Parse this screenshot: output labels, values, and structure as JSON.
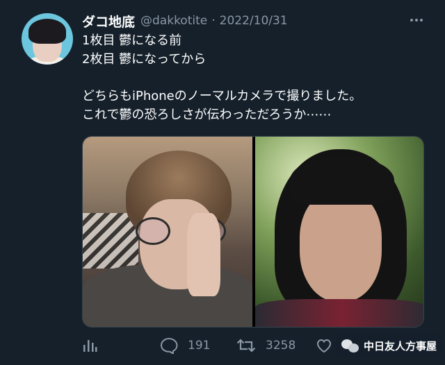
{
  "author": {
    "display_name": "ダコ地底",
    "handle": "@dakkotite",
    "separator": "·",
    "date": "2022/10/31"
  },
  "tweet": {
    "lines": [
      "1枚目  鬱になる前",
      "2枚目  鬱になってから",
      "",
      "どちらもiPhoneのノーマルカメラで撮りました。",
      "これで鬱の恐ろしさが伝わっただろうか⋯⋯"
    ]
  },
  "media": {
    "photos": [
      "before-photo",
      "after-photo"
    ]
  },
  "actions": {
    "analytics_icon": "analytics-icon",
    "reply_count": "191",
    "retweet_count": "3258",
    "like_icon": "heart-icon"
  },
  "watermark": {
    "text": "中日友人方事屋"
  },
  "colors": {
    "background": "#15202b",
    "secondary_text": "#8b98a5",
    "primary_text": "#ffffff"
  }
}
